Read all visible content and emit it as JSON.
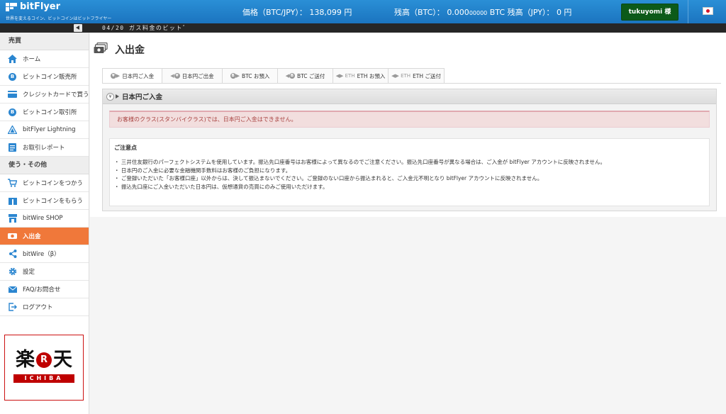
{
  "header": {
    "brand": "bitFlyer",
    "tagline": "世界を変えるコイン、ビットコインはビットフライヤー",
    "price_label": "価格（BTC/JPY）：",
    "price_value": "138,099 円",
    "btc_balance_label": "残高（BTC）：",
    "btc_balance_main": "0.000",
    "btc_balance_small": "00000",
    "btc_balance_unit": "BTC",
    "jpy_balance_label": "残高（JPY）：",
    "jpy_balance_value": "0 円",
    "user_button": "tukuyomi 様",
    "language_icon": "japan-flag-icon"
  },
  "ticker": {
    "text": "04/20 ガス料金のビット゛"
  },
  "sidebar": {
    "section1": "売買",
    "section2": "使う・その他",
    "items": [
      {
        "label": "ホーム",
        "icon": "home-icon"
      },
      {
        "label": "ビットコイン販売所",
        "icon": "bitcoin-icon"
      },
      {
        "label": "クレジットカードで買う",
        "icon": "credit-card-icon"
      },
      {
        "label": "ビットコイン取引所",
        "icon": "bitcoin-icon"
      },
      {
        "label": "bitFlyer Lightning",
        "icon": "lightning-icon"
      },
      {
        "label": "お取引レポート",
        "icon": "report-icon"
      },
      {
        "label": "ビットコインをつかう",
        "icon": "cart-icon"
      },
      {
        "label": "ビットコインをもらう",
        "icon": "receive-icon"
      },
      {
        "label": "bitWire SHOP",
        "icon": "shop-icon"
      },
      {
        "label": "入出金",
        "icon": "money-icon"
      },
      {
        "label": "bitWire（β）",
        "icon": "share-icon"
      },
      {
        "label": "設定",
        "icon": "gear-icon"
      },
      {
        "label": "FAQ/お問合せ",
        "icon": "mail-icon"
      },
      {
        "label": "ログアウト",
        "icon": "logout-icon"
      }
    ],
    "ad": {
      "char1": "楽",
      "char2": "R",
      "char3": "天",
      "sub": "ICHIBA"
    }
  },
  "main": {
    "title": "入出金",
    "tabs": [
      {
        "label": "日本円ご入金",
        "icon": "¥"
      },
      {
        "label": "日本円ご出金",
        "icon": "¥"
      },
      {
        "label": "BTC お預入",
        "icon": "B"
      },
      {
        "label": "BTC ご送付",
        "icon": "B"
      },
      {
        "label": "ETH お預入",
        "icon": "ETH"
      },
      {
        "label": "ETH ご送付",
        "icon": "ETH"
      }
    ],
    "panel_icon_symbol": "¥",
    "panel_title": "日本円ご入金",
    "alert": "お客様のクラス(スタンバイクラス)では、日本円ご入金はできません。",
    "notes_title": "ご注意点",
    "notes": [
      "・ 三井住友銀行のパーフェクトシステムを使用しています。振込先口座番号はお客様によって異なるのでご注意ください。振込先口座番号が異なる場合は、ご入金が bitFlyer アカウントに反映されません。",
      "・ 日本円のご入金に必要な金融機関手数料はお客様のご負担になります。",
      "・ ご登録いただいた「お客様口座」以外からは、決して振込まないでください。ご登録のない口座から振込まれると、ご入金元不明となり bitFlyer アカウントに反映されません。",
      "・ 振込先口座にご入金いただいた日本円は、仮想通貨の売買にのみご使用いただけます。"
    ]
  },
  "colors": {
    "header_blue": "#1b74bf",
    "active_orange": "#f0783a",
    "user_green": "#0c5a19",
    "alert_text": "#a94442",
    "icon_blue": "#2b86d0"
  }
}
